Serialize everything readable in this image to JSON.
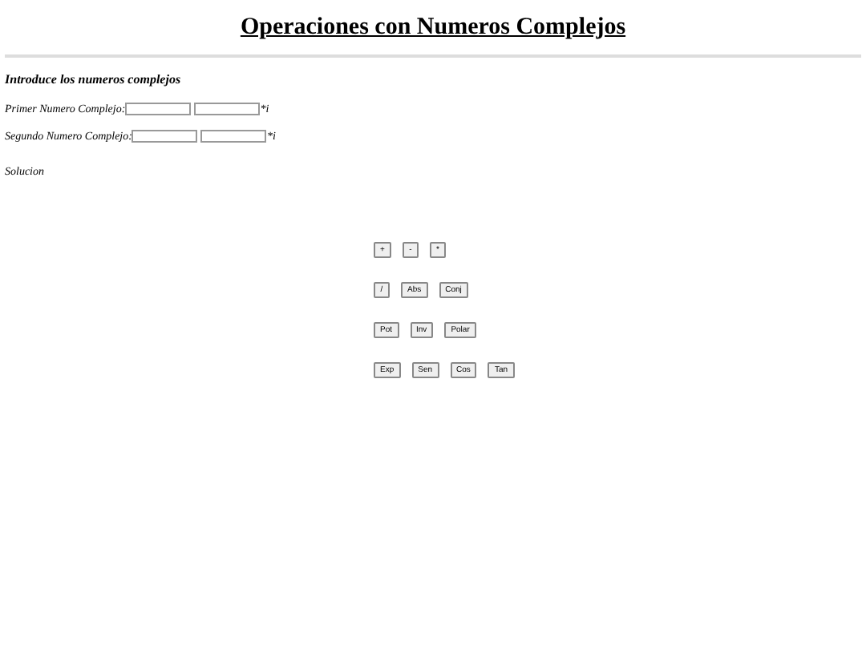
{
  "title": "Operaciones con Numeros Complejos",
  "intro": "Introduce los numeros complejos",
  "fields": [
    {
      "label": "Primer Numero Complejo:",
      "suffix": "*i"
    },
    {
      "label": "Segundo Numero Complejo:",
      "suffix": "*i"
    }
  ],
  "solution_label": "Solucion",
  "button_rows": [
    [
      "+",
      "-",
      "*"
    ],
    [
      "/",
      "Abs",
      "Conj"
    ],
    [
      "Pot",
      "Inv",
      "Polar"
    ],
    [
      "Exp",
      "Sen",
      "Cos",
      "Tan"
    ]
  ]
}
